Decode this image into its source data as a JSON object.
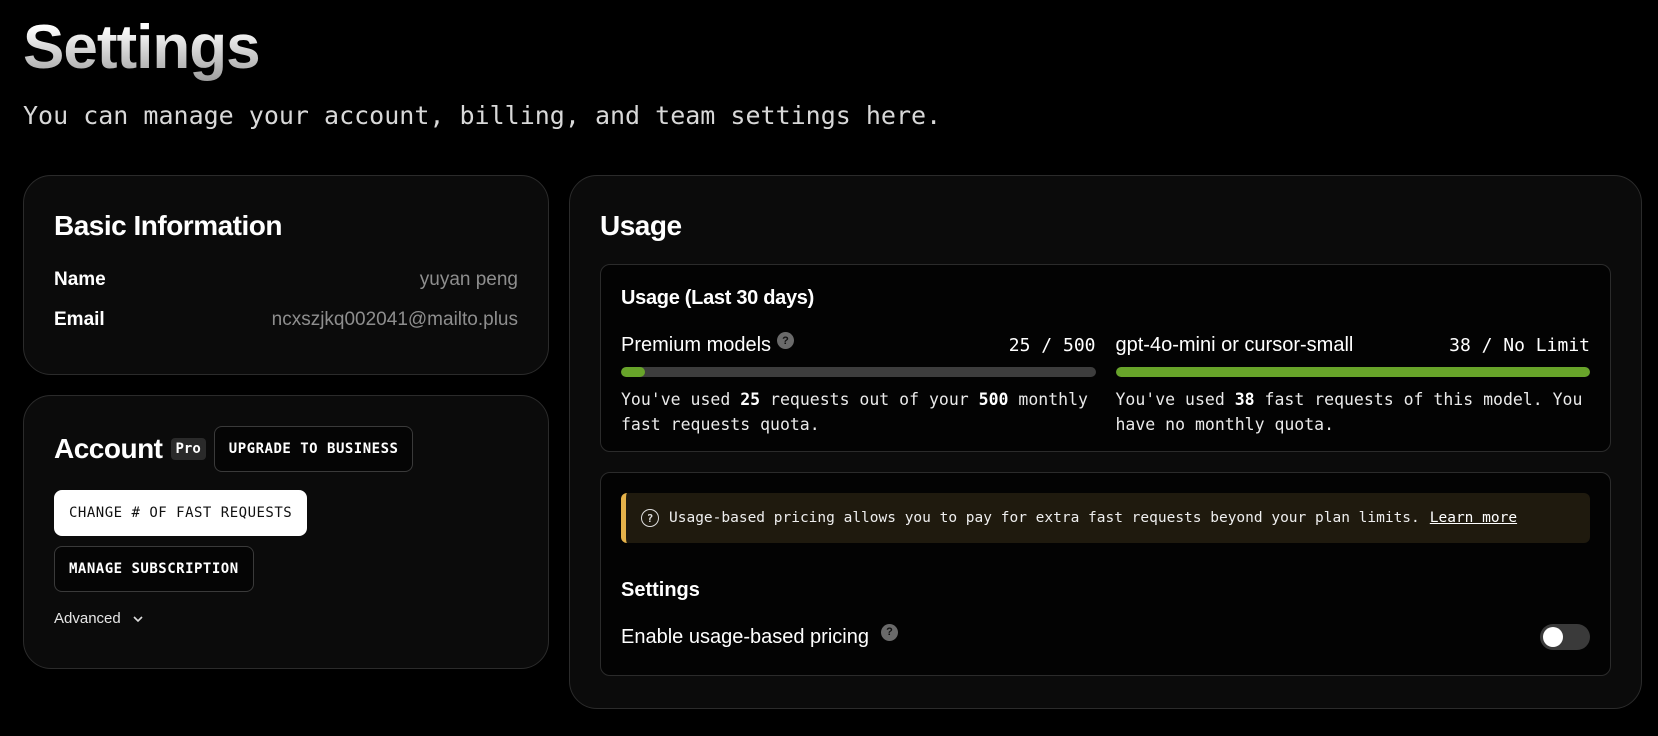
{
  "page": {
    "title": "Settings",
    "subtitle": "You can manage your account, billing, and team settings here."
  },
  "basic_info": {
    "title": "Basic Information",
    "name_label": "Name",
    "name_value": "yuyan peng",
    "email_label": "Email",
    "email_value": "ncxszjkq002041@mailto.plus"
  },
  "account": {
    "title": "Account",
    "plan_badge": "Pro",
    "upgrade_label": "UPGRADE TO BUSINESS",
    "change_requests_label": "CHANGE # OF FAST REQUESTS",
    "manage_subscription_label": "MANAGE SUBSCRIPTION",
    "advanced_label": "Advanced",
    "advanced_icon": "chevron-down-icon"
  },
  "usage": {
    "title": "Usage",
    "box_title": "Usage (Last 30 days)",
    "premium": {
      "name": "Premium models",
      "count": "25 / 500",
      "used": "25",
      "limit": "500",
      "fraction": 0.05,
      "desc_prefix": "You've used",
      "desc_mid": "requests out of your",
      "desc_suffix": "monthly fast requests quota."
    },
    "small": {
      "name": "gpt-4o-mini or cursor-small",
      "count": "38 / No Limit",
      "used": "38",
      "fraction": 1.0,
      "desc_prefix": "You've used",
      "desc_suffix": "fast requests of this model. You have no monthly quota."
    },
    "bar_color": "#68a42a"
  },
  "pricing": {
    "banner_text": "Usage-based pricing allows you to pay for extra fast requests beyond your plan limits.",
    "learn_more": "Learn more",
    "settings_title": "Settings",
    "toggle_label": "Enable usage-based pricing",
    "toggle_on": false,
    "accent_color": "#e5b24a"
  }
}
